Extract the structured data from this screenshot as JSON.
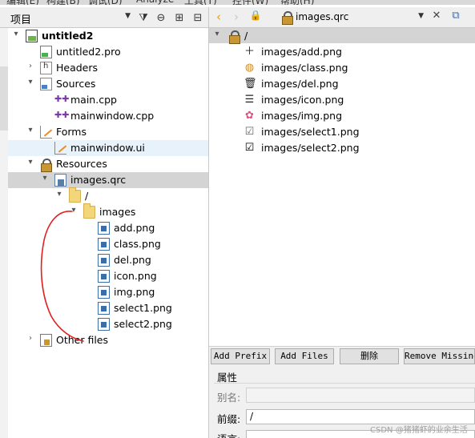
{
  "menubar": {
    "items": [
      "编辑(E)",
      "构建(B)",
      "调试(D)",
      "Analyze",
      "工具(T)",
      "控件(W)",
      "帮助(H)"
    ]
  },
  "left": {
    "selector": "项目",
    "tree": [
      {
        "label": "untitled2",
        "icon": "project-icon",
        "bold": true,
        "expanded": true
      },
      {
        "label": "untitled2.pro",
        "icon": "pro-file-icon"
      },
      {
        "label": "Headers",
        "icon": "headers-folder-icon",
        "expanded": false
      },
      {
        "label": "Sources",
        "icon": "sources-folder-icon",
        "expanded": true
      },
      {
        "label": "main.cpp",
        "icon": "cpp-file-icon"
      },
      {
        "label": "mainwindow.cpp",
        "icon": "cpp-file-icon"
      },
      {
        "label": "Forms",
        "icon": "forms-folder-icon",
        "expanded": true
      },
      {
        "label": "mainwindow.ui",
        "icon": "ui-file-icon"
      },
      {
        "label": "Resources",
        "icon": "resources-lock-icon",
        "expanded": true
      },
      {
        "label": "images.qrc",
        "icon": "qrc-file-icon",
        "expanded": true,
        "selected": true
      },
      {
        "label": "/",
        "icon": "folder-icon",
        "expanded": true
      },
      {
        "label": "images",
        "icon": "folder-icon",
        "expanded": true
      },
      {
        "label": "add.png",
        "icon": "png-file-icon"
      },
      {
        "label": "class.png",
        "icon": "png-file-icon"
      },
      {
        "label": "del.png",
        "icon": "png-file-icon"
      },
      {
        "label": "icon.png",
        "icon": "png-file-icon"
      },
      {
        "label": "img.png",
        "icon": "png-file-icon"
      },
      {
        "label": "select1.png",
        "icon": "png-file-icon"
      },
      {
        "label": "select2.png",
        "icon": "png-file-icon"
      },
      {
        "label": "Other files",
        "icon": "other-files-icon",
        "expanded": false
      }
    ]
  },
  "editor": {
    "document": "images.qrc",
    "prefix": "/",
    "files": [
      {
        "path": "images/add.png",
        "glyph": "＋",
        "icon": "add-icon"
      },
      {
        "path": "images/class.png",
        "glyph": "◍",
        "icon": "class-icon"
      },
      {
        "path": "images/del.png",
        "glyph": "🗑",
        "icon": "trash-icon"
      },
      {
        "path": "images/icon.png",
        "glyph": "☰",
        "icon": "list-icon"
      },
      {
        "path": "images/img.png",
        "glyph": "✿",
        "icon": "flower-icon"
      },
      {
        "path": "images/select1.png",
        "glyph": "☑",
        "icon": "checkbox-empty-icon"
      },
      {
        "path": "images/select2.png",
        "glyph": "☑",
        "icon": "checkbox-checked-icon"
      }
    ]
  },
  "buttons": {
    "add_prefix": "Add Prefix",
    "add_files": "Add Files",
    "delete": "删除",
    "remove_missing": "Remove Missing"
  },
  "properties": {
    "title": "属性",
    "alias_label": "别名:",
    "alias_value": "",
    "prefix_label": "前缀:",
    "prefix_value": "/",
    "lang_label": "语言:"
  },
  "watermark": "CSDN @猪猪虾的业余生活",
  "colors": {
    "selection": "#d4d4d4",
    "highlight": "#e8f2fb",
    "annotation": "#e02020",
    "back_arrow": "#e0a020"
  }
}
